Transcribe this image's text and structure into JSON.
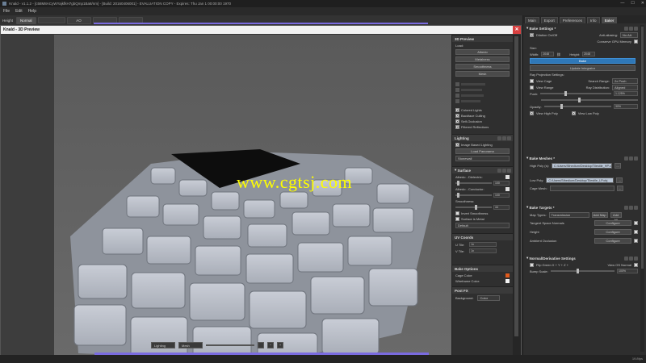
{
  "window": {
    "title": "Knald - v1.1.2 - [c58M8ACyWYajkfkH7gbQmp1Ba8/nm] - [Build: 20160406001] - EVALUATION COPY - Expires: Thu Jan 1 00:00:00 1970",
    "minimize": "—",
    "maximize": "☐",
    "close": "✕"
  },
  "menu": [
    "File",
    "Edit",
    "Help"
  ],
  "mapbar": {
    "height_label": "Height",
    "tabs": [
      "Normal",
      "",
      "AO",
      "",
      "",
      ""
    ],
    "active_tab": "Normal"
  },
  "preview": {
    "title": "Knald - 3D Preview",
    "close": "✕",
    "watermark": "www.cgtsj.com",
    "toolbar": {
      "mode": "Lighting",
      "display": "Mesh",
      "zoom_out": "−",
      "zoom_in": "+"
    },
    "sidebar": {
      "preview3d": {
        "title": "3D Preview",
        "load_label": "Load:",
        "buttons": [
          "Albedo",
          "Metalness",
          "Smoothness",
          "Mesh"
        ],
        "options": [
          {
            "label": "Colored Lights",
            "checked": true
          },
          {
            "label": "Backface Culling",
            "checked": true
          },
          {
            "label": "Self-Occlusion",
            "checked": true
          },
          {
            "label": "Filtered Reflections",
            "checked": true
          }
        ]
      },
      "lighting": {
        "title": "Lighting",
        "ibl_label": "Image Based Lighting",
        "ibl_checked": true,
        "load_panorama": "Load Panorama",
        "preset": "Stonewall"
      },
      "surface": {
        "title": "Surface",
        "albedo_dielectric": "Albedo - Dielectric:",
        "albedo_dielectric_value": "100",
        "albedo_conductor": "Albedo - Conductor:",
        "albedo_conductor_value": "100",
        "smoothness": "Smoothness:",
        "smoothness_value": "44",
        "invert_smoothness": "Invert Smoothness",
        "surface_is_metal": "Surface is Metal",
        "mode": "Default"
      },
      "uv": {
        "title": "UV Coords",
        "u_label": "U Tile:",
        "u_value": "1x",
        "v_label": "V Tile:",
        "v_value": "1x"
      },
      "bake_options": {
        "title": "Bake Options",
        "cage_color": "Cage Color:",
        "cage_color_hex": "#e05a1c",
        "wireframe_color": "Wireframe Color:",
        "wireframe_color_hex": "#f2f2f2"
      },
      "post_fx": {
        "title": "Post FX",
        "background_label": "Background:",
        "background_value": "Color"
      }
    }
  },
  "right_panel": {
    "tabs": [
      "Main",
      "Export",
      "Preferences",
      "Info",
      "Baker"
    ],
    "active_tab": "Baker",
    "bake_settings": {
      "title": "Bake Settings *",
      "dilation": "Dilation On/Off",
      "anti_aliasing_label": "Anti-aliasing:",
      "anti_aliasing_value": "No AA",
      "conserve_gpu": "Conserve GPU Memory",
      "size_label": "Size:",
      "width_label": "Width:",
      "width_value": "2048",
      "height_label": "Height:",
      "height_value": "2048",
      "bake_button": "Bake",
      "update_integrator": "Update Integrator",
      "ray_settings": "Ray Projection Settings:",
      "view_cage": "View Cage",
      "search_range_label": "Search Range:",
      "search_range_value": "2x Push",
      "view_range": "View Range",
      "ray_distribution_label": "Ray Distribution:",
      "ray_distribution_value": "Aligned",
      "push_label": "Push:",
      "push_value": "1.125%",
      "opacity_label": "Opacity:",
      "opacity_value": "30%",
      "view_high_poly": "View High Poly",
      "view_low_poly": "View Low Poly"
    },
    "bake_meshes": {
      "title": "Bake Meshes *",
      "high_poly_label": "High Poly (s):",
      "high_poly_path": "C:/Users/Sthedium/Desktop/Tilestile_HP.obj",
      "low_poly_label": "Low Poly:",
      "low_poly_path": "C:/Users/Sthedium/Desktop/Tilestile_LP.obj",
      "cage_label": "Cage Mesh:",
      "browse": "..."
    },
    "bake_targets": {
      "title": "Bake Targets *",
      "map_types_label": "Map Types:",
      "map_types_value": "Transmission",
      "add_map": "Add Map",
      "add_all": "Add All",
      "rows": [
        {
          "label": "Tangent Space Normals",
          "button": "Configure"
        },
        {
          "label": "Height",
          "button": "Configure"
        },
        {
          "label": "Ambient Occlusion",
          "button": "Configure"
        }
      ]
    },
    "normal_settings": {
      "title": "Normal/Derivative Settings",
      "flip_green": "Flip Green  X + Y + Z +",
      "view_os_normal": "View OS Normal",
      "bump_scale_label": "Bump Scale:",
      "bump_scale_value": "100%"
    }
  },
  "status": {
    "memory": "19.8fps"
  },
  "colors": {
    "accent_purple": "#7a6be0",
    "bake_blue": "#2f78b8",
    "watermark_yellow": "#ffff00"
  }
}
